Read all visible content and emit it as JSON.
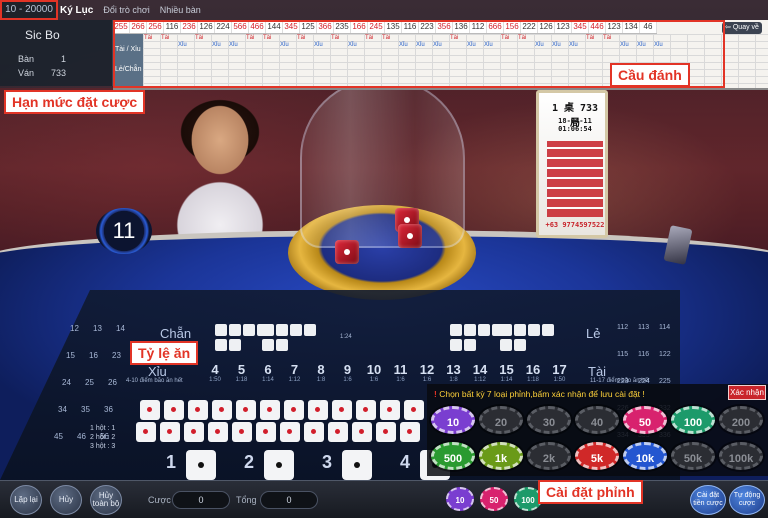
{
  "top": {
    "limit": "10 - 20000",
    "tabs": [
      "Ký Lục",
      "Đổi trò chơi",
      "Nhiều bàn"
    ],
    "back_label": "Quay về"
  },
  "side": {
    "title": "Sic Bo",
    "ban_label": "Bàn",
    "ban_value": "1",
    "van_label": "Ván",
    "van_value": "733"
  },
  "board": {
    "side_labels": [
      "Tài / Xỉu",
      "Lẻ/Chẵn"
    ],
    "numbers": [
      "255",
      "266",
      "256",
      "116",
      "236",
      "126",
      "224",
      "566",
      "466",
      "144",
      "345",
      "125",
      "366",
      "235",
      "166",
      "245",
      "135",
      "116",
      "223",
      "356",
      "136",
      "112",
      "666",
      "156",
      "222",
      "126",
      "123",
      "345",
      "446",
      "123",
      "134",
      "46"
    ],
    "tai_word": "Tài",
    "xiu_word": "Xỉu"
  },
  "timer": "11",
  "sign": {
    "line1": "1 桌 733 局",
    "line2": "18-04-11 01:06:54",
    "phone": "+63 9774597522"
  },
  "betting": {
    "chan": "Chẵn",
    "le": "Lẻ",
    "xiu": "Xỉu",
    "tai": "Tài",
    "xiu_sub": "4-10 điểm bão ăn hết",
    "tai_sub": "11-17 điểm bão ăn hết",
    "totals": [
      "4",
      "5",
      "6",
      "7",
      "8",
      "9",
      "10",
      "11",
      "12",
      "13",
      "14",
      "15",
      "16",
      "17"
    ],
    "odds": [
      "1:50",
      "1:18",
      "1:14",
      "1:12",
      "1:8",
      "1:6",
      "1:6",
      "1:6",
      "1:6",
      "1:8",
      "1:12",
      "1:14",
      "1:18",
      "1:50"
    ],
    "left_pairs": [
      "12",
      "13",
      "14",
      "15",
      "16",
      "23",
      "24",
      "25",
      "26",
      "34",
      "35",
      "36",
      "45",
      "46",
      "56"
    ],
    "right_pairs": [
      "112",
      "113",
      "114",
      "115",
      "116",
      "122",
      "223",
      "224",
      "225",
      "226",
      "331",
      "332",
      "334",
      "335",
      "336"
    ],
    "hit_lines": [
      "1 hột : 1",
      "2 hột : 2",
      "3 hột : 3"
    ],
    "singles": [
      "1",
      "2",
      "3",
      "4"
    ],
    "triple_odds": "1:24",
    "triple_note": "Tất cả 3 số giống nhau"
  },
  "chips_panel": {
    "message": "Chọn bất kỳ 7 loại phỉnh,bấm xác nhận để lưu cài đặt !",
    "confirm": "Xác nhận",
    "chips": [
      {
        "label": "10",
        "color": "#7a3ed0",
        "selected": true
      },
      {
        "label": "20",
        "color": "#2b2d33",
        "selected": false
      },
      {
        "label": "30",
        "color": "#2b2d33",
        "selected": false
      },
      {
        "label": "40",
        "color": "#2b2d33",
        "selected": false
      },
      {
        "label": "50",
        "color": "#d8226e",
        "selected": true
      },
      {
        "label": "100",
        "color": "#1c9a6a",
        "selected": true
      },
      {
        "label": "200",
        "color": "#2b2d33",
        "selected": false
      },
      {
        "label": "500",
        "color": "#2a9a30",
        "selected": true
      },
      {
        "label": "1k",
        "color": "#6a9a18",
        "selected": true
      },
      {
        "label": "2k",
        "color": "#2b2d33",
        "selected": false
      },
      {
        "label": "5k",
        "color": "#d02828",
        "selected": true
      },
      {
        "label": "10k",
        "color": "#2456d0",
        "selected": true
      },
      {
        "label": "50k",
        "color": "#2b2d33",
        "selected": false
      },
      {
        "label": "100k",
        "color": "#2b2d33",
        "selected": false
      }
    ]
  },
  "bottom": {
    "lap_lai": "Lặp lại",
    "huy": "Hủy",
    "huy_toan_bo": "Hủy toàn bộ",
    "cuoc_label": "Cược",
    "cuoc_value": "0",
    "tong_label": "Tổng",
    "tong_value": "0",
    "mini_chips": [
      {
        "label": "10",
        "color": "#7a3ed0"
      },
      {
        "label": "50",
        "color": "#d8226e"
      },
      {
        "label": "100",
        "color": "#1c9a6a"
      }
    ],
    "cai_dat": "Cài đặt tiền cược",
    "tu_dong": "Tự động cược"
  },
  "annotations": {
    "limit": "Hạn mức đặt cược",
    "road": "Cầu đánh",
    "odds": "Tỷ lệ ăn",
    "chips": "Cài đặt phỉnh"
  }
}
